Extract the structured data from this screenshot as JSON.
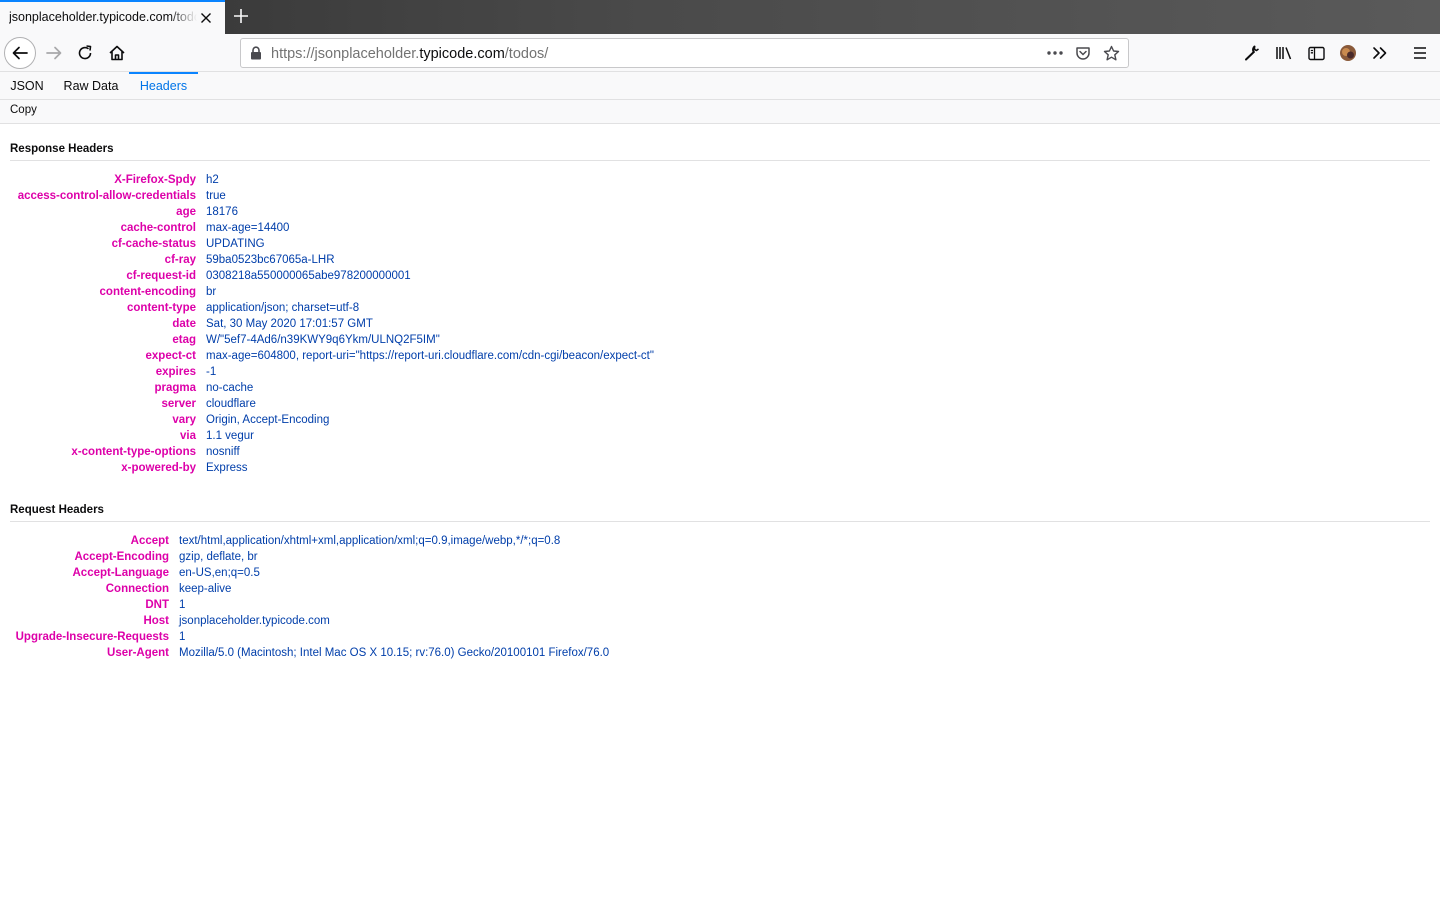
{
  "browser": {
    "tab_title": "jsonplaceholder.typicode.com/todos/",
    "url_scheme": "https://",
    "url_host_prefix": "jsonplaceholder.",
    "url_host_domain": "typicode.com",
    "url_path": "/todos/",
    "accent_color": "#0a84ff"
  },
  "viewer": {
    "tabs": [
      {
        "label": "JSON"
      },
      {
        "label": "Raw Data"
      },
      {
        "label": "Headers",
        "selected": true
      }
    ],
    "copy_label": "Copy"
  },
  "response_headers": {
    "title": "Response Headers",
    "items": [
      {
        "name": "X-Firefox-Spdy",
        "value": "h2"
      },
      {
        "name": "access-control-allow-credentials",
        "value": "true"
      },
      {
        "name": "age",
        "value": "18176"
      },
      {
        "name": "cache-control",
        "value": "max-age=14400"
      },
      {
        "name": "cf-cache-status",
        "value": "UPDATING"
      },
      {
        "name": "cf-ray",
        "value": "59ba0523bc67065a-LHR"
      },
      {
        "name": "cf-request-id",
        "value": "0308218a550000065abe978200000001"
      },
      {
        "name": "content-encoding",
        "value": "br"
      },
      {
        "name": "content-type",
        "value": "application/json; charset=utf-8"
      },
      {
        "name": "date",
        "value": "Sat, 30 May 2020 17:01:57 GMT"
      },
      {
        "name": "etag",
        "value": "W/\"5ef7-4Ad6/n39KWY9q6Ykm/ULNQ2F5IM\""
      },
      {
        "name": "expect-ct",
        "value": "max-age=604800, report-uri=\"https://report-uri.cloudflare.com/cdn-cgi/beacon/expect-ct\""
      },
      {
        "name": "expires",
        "value": "-1"
      },
      {
        "name": "pragma",
        "value": "no-cache"
      },
      {
        "name": "server",
        "value": "cloudflare"
      },
      {
        "name": "vary",
        "value": "Origin, Accept-Encoding"
      },
      {
        "name": "via",
        "value": "1.1 vegur"
      },
      {
        "name": "x-content-type-options",
        "value": "nosniff"
      },
      {
        "name": "x-powered-by",
        "value": "Express"
      }
    ]
  },
  "request_headers": {
    "title": "Request Headers",
    "items": [
      {
        "name": "Accept",
        "value": "text/html,application/xhtml+xml,application/xml;q=0.9,image/webp,*/*;q=0.8"
      },
      {
        "name": "Accept-Encoding",
        "value": "gzip, deflate, br"
      },
      {
        "name": "Accept-Language",
        "value": "en-US,en;q=0.5"
      },
      {
        "name": "Connection",
        "value": "keep-alive"
      },
      {
        "name": "DNT",
        "value": "1"
      },
      {
        "name": "Host",
        "value": "jsonplaceholder.typicode.com"
      },
      {
        "name": "Upgrade-Insecure-Requests",
        "value": "1"
      },
      {
        "name": "User-Agent",
        "value": "Mozilla/5.0 (Macintosh; Intel Mac OS X 10.15; rv:76.0) Gecko/20100101 Firefox/76.0"
      }
    ]
  },
  "colors": {
    "header_name": "#dd00a9",
    "header_value": "#003eaa",
    "selected_tab_text": "#0074e8"
  },
  "icons": [
    "close-icon",
    "plus-icon",
    "back-arrow-icon",
    "forward-arrow-icon",
    "reload-icon",
    "home-icon",
    "lock-icon",
    "more-icon",
    "pocket-icon",
    "star-icon",
    "wrench-icon",
    "library-icon",
    "sidebar-icon",
    "avatar",
    "overflow-chevrons-icon",
    "hamburger-menu-icon"
  ]
}
